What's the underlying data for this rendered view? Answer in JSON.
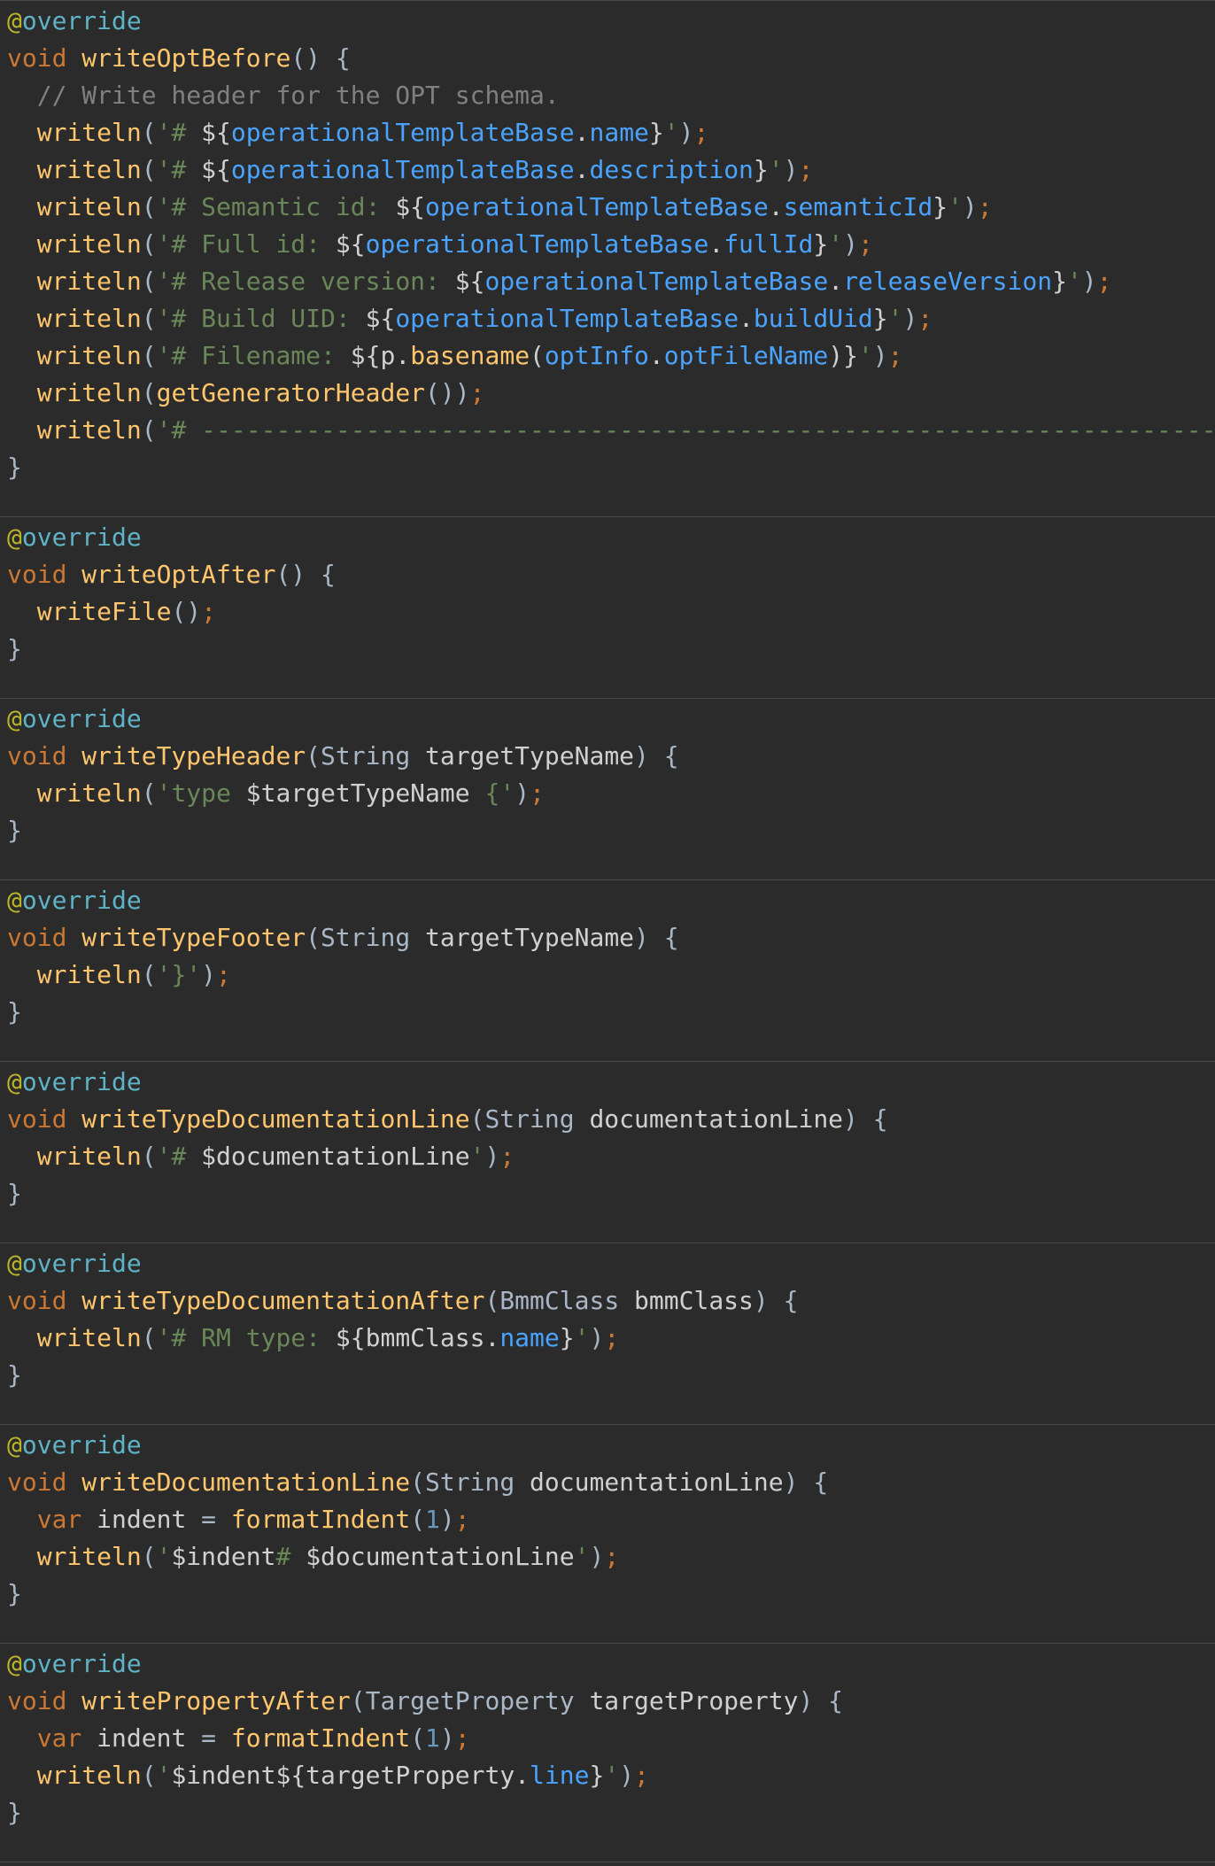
{
  "colors": {
    "background": "#2b2b2b",
    "annotation_at": "#bbb529",
    "annotation_name": "#5fb3c6",
    "keyword": "#cc7832",
    "method": "#ffc66d",
    "string": "#6a8759",
    "field": "#4aa3ff",
    "comment": "#808080",
    "number": "#6897bb",
    "plain": "#a9b7c6"
  },
  "code_blocks": [
    {
      "lines": [
        [
          [
            "ann",
            "@"
          ],
          [
            "ann2",
            "override"
          ]
        ],
        [
          [
            "kw",
            "void "
          ],
          [
            "def",
            "writeOptBefore"
          ],
          [
            "pl",
            "() {"
          ]
        ],
        [
          [
            "pl",
            "  "
          ],
          [
            "com",
            "// Write header for the OPT schema."
          ]
        ],
        [
          [
            "pl",
            "  "
          ],
          [
            "fn",
            "writeln"
          ],
          [
            "pl",
            "("
          ],
          [
            "str",
            "'# "
          ],
          [
            "id",
            "${"
          ],
          [
            "fld",
            "operationalTemplateBase"
          ],
          [
            "id",
            "."
          ],
          [
            "fld",
            "name"
          ],
          [
            "id",
            "}"
          ],
          [
            "str",
            "'"
          ],
          [
            "pl",
            ")"
          ],
          [
            "kw",
            ";"
          ]
        ],
        [
          [
            "pl",
            "  "
          ],
          [
            "fn",
            "writeln"
          ],
          [
            "pl",
            "("
          ],
          [
            "str",
            "'# "
          ],
          [
            "id",
            "${"
          ],
          [
            "fld",
            "operationalTemplateBase"
          ],
          [
            "id",
            "."
          ],
          [
            "fld",
            "description"
          ],
          [
            "id",
            "}"
          ],
          [
            "str",
            "'"
          ],
          [
            "pl",
            ")"
          ],
          [
            "kw",
            ";"
          ]
        ],
        [
          [
            "pl",
            "  "
          ],
          [
            "fn",
            "writeln"
          ],
          [
            "pl",
            "("
          ],
          [
            "str",
            "'# Semantic id: "
          ],
          [
            "id",
            "${"
          ],
          [
            "fld",
            "operationalTemplateBase"
          ],
          [
            "id",
            "."
          ],
          [
            "fld",
            "semanticId"
          ],
          [
            "id",
            "}"
          ],
          [
            "str",
            "'"
          ],
          [
            "pl",
            ")"
          ],
          [
            "kw",
            ";"
          ]
        ],
        [
          [
            "pl",
            "  "
          ],
          [
            "fn",
            "writeln"
          ],
          [
            "pl",
            "("
          ],
          [
            "str",
            "'# Full id: "
          ],
          [
            "id",
            "${"
          ],
          [
            "fld",
            "operationalTemplateBase"
          ],
          [
            "id",
            "."
          ],
          [
            "fld",
            "fullId"
          ],
          [
            "id",
            "}"
          ],
          [
            "str",
            "'"
          ],
          [
            "pl",
            ")"
          ],
          [
            "kw",
            ";"
          ]
        ],
        [
          [
            "pl",
            "  "
          ],
          [
            "fn",
            "writeln"
          ],
          [
            "pl",
            "("
          ],
          [
            "str",
            "'# Release version: "
          ],
          [
            "id",
            "${"
          ],
          [
            "fld",
            "operationalTemplateBase"
          ],
          [
            "id",
            "."
          ],
          [
            "fld",
            "releaseVersion"
          ],
          [
            "id",
            "}"
          ],
          [
            "str",
            "'"
          ],
          [
            "pl",
            ")"
          ],
          [
            "kw",
            ";"
          ]
        ],
        [
          [
            "pl",
            "  "
          ],
          [
            "fn",
            "writeln"
          ],
          [
            "pl",
            "("
          ],
          [
            "str",
            "'# Build UID: "
          ],
          [
            "id",
            "${"
          ],
          [
            "fld",
            "operationalTemplateBase"
          ],
          [
            "id",
            "."
          ],
          [
            "fld",
            "buildUid"
          ],
          [
            "id",
            "}"
          ],
          [
            "str",
            "'"
          ],
          [
            "pl",
            ")"
          ],
          [
            "kw",
            ";"
          ]
        ],
        [
          [
            "pl",
            "  "
          ],
          [
            "fn",
            "writeln"
          ],
          [
            "pl",
            "("
          ],
          [
            "str",
            "'# Filename: "
          ],
          [
            "id",
            "${p."
          ],
          [
            "fn",
            "basename"
          ],
          [
            "id",
            "("
          ],
          [
            "fld",
            "optInfo"
          ],
          [
            "id",
            "."
          ],
          [
            "fld",
            "optFileName"
          ],
          [
            "id",
            ")}"
          ],
          [
            "str",
            "'"
          ],
          [
            "pl",
            ")"
          ],
          [
            "kw",
            ";"
          ]
        ],
        [
          [
            "pl",
            "  "
          ],
          [
            "fn",
            "writeln"
          ],
          [
            "pl",
            "("
          ],
          [
            "fn",
            "getGeneratorHeader"
          ],
          [
            "pl",
            "())"
          ],
          [
            "kw",
            ";"
          ]
        ],
        [
          [
            "pl",
            "  "
          ],
          [
            "fn",
            "writeln"
          ],
          [
            "pl",
            "("
          ],
          [
            "str",
            "'# ----------------------------------------------------------------------'"
          ],
          [
            "pl",
            ")"
          ],
          [
            "kw",
            ";"
          ]
        ],
        [
          [
            "pl",
            "}"
          ]
        ]
      ]
    },
    {
      "lines": [
        [
          [
            "ann",
            "@"
          ],
          [
            "ann2",
            "override"
          ]
        ],
        [
          [
            "kw",
            "void "
          ],
          [
            "def",
            "writeOptAfter"
          ],
          [
            "pl",
            "() {"
          ]
        ],
        [
          [
            "pl",
            "  "
          ],
          [
            "fn",
            "writeFile"
          ],
          [
            "pl",
            "()"
          ],
          [
            "kw",
            ";"
          ]
        ],
        [
          [
            "pl",
            "}"
          ]
        ]
      ]
    },
    {
      "lines": [
        [
          [
            "ann",
            "@"
          ],
          [
            "ann2",
            "override"
          ]
        ],
        [
          [
            "kw",
            "void "
          ],
          [
            "def",
            "writeTypeHeader"
          ],
          [
            "pl",
            "(String "
          ],
          [
            "id",
            "targetTypeName"
          ],
          [
            "pl",
            ") {"
          ]
        ],
        [
          [
            "pl",
            "  "
          ],
          [
            "fn",
            "writeln"
          ],
          [
            "pl",
            "("
          ],
          [
            "str",
            "'type "
          ],
          [
            "id",
            "$targetTypeName"
          ],
          [
            "str",
            " {'"
          ],
          [
            "pl",
            ")"
          ],
          [
            "kw",
            ";"
          ]
        ],
        [
          [
            "pl",
            "}"
          ]
        ]
      ]
    },
    {
      "lines": [
        [
          [
            "ann",
            "@"
          ],
          [
            "ann2",
            "override"
          ]
        ],
        [
          [
            "kw",
            "void "
          ],
          [
            "def",
            "writeTypeFooter"
          ],
          [
            "pl",
            "(String "
          ],
          [
            "id",
            "targetTypeName"
          ],
          [
            "pl",
            ") {"
          ]
        ],
        [
          [
            "pl",
            "  "
          ],
          [
            "fn",
            "writeln"
          ],
          [
            "pl",
            "("
          ],
          [
            "str",
            "'}'"
          ],
          [
            "pl",
            ")"
          ],
          [
            "kw",
            ";"
          ]
        ],
        [
          [
            "pl",
            "}"
          ]
        ]
      ]
    },
    {
      "lines": [
        [
          [
            "ann",
            "@"
          ],
          [
            "ann2",
            "override"
          ]
        ],
        [
          [
            "kw",
            "void "
          ],
          [
            "def",
            "writeTypeDocumentationLine"
          ],
          [
            "pl",
            "(String "
          ],
          [
            "id",
            "documentationLine"
          ],
          [
            "pl",
            ") {"
          ]
        ],
        [
          [
            "pl",
            "  "
          ],
          [
            "fn",
            "writeln"
          ],
          [
            "pl",
            "("
          ],
          [
            "str",
            "'# "
          ],
          [
            "id",
            "$documentationLine"
          ],
          [
            "str",
            "'"
          ],
          [
            "pl",
            ")"
          ],
          [
            "kw",
            ";"
          ]
        ],
        [
          [
            "pl",
            "}"
          ]
        ]
      ]
    },
    {
      "lines": [
        [
          [
            "ann",
            "@"
          ],
          [
            "ann2",
            "override"
          ]
        ],
        [
          [
            "kw",
            "void "
          ],
          [
            "def",
            "writeTypeDocumentationAfter"
          ],
          [
            "pl",
            "(BmmClass "
          ],
          [
            "id",
            "bmmClass"
          ],
          [
            "pl",
            ") {"
          ]
        ],
        [
          [
            "pl",
            "  "
          ],
          [
            "fn",
            "writeln"
          ],
          [
            "pl",
            "("
          ],
          [
            "str",
            "'# RM type: "
          ],
          [
            "id",
            "${bmmClass."
          ],
          [
            "fld",
            "name"
          ],
          [
            "id",
            "}"
          ],
          [
            "str",
            "'"
          ],
          [
            "pl",
            ")"
          ],
          [
            "kw",
            ";"
          ]
        ],
        [
          [
            "pl",
            "}"
          ]
        ]
      ]
    },
    {
      "lines": [
        [
          [
            "ann",
            "@"
          ],
          [
            "ann2",
            "override"
          ]
        ],
        [
          [
            "kw",
            "void "
          ],
          [
            "def",
            "writeDocumentationLine"
          ],
          [
            "pl",
            "(String "
          ],
          [
            "id",
            "documentationLine"
          ],
          [
            "pl",
            ") {"
          ]
        ],
        [
          [
            "pl",
            "  "
          ],
          [
            "kw",
            "var "
          ],
          [
            "id",
            "indent "
          ],
          [
            "pl",
            "= "
          ],
          [
            "fn",
            "formatIndent"
          ],
          [
            "pl",
            "("
          ],
          [
            "num",
            "1"
          ],
          [
            "pl",
            ")"
          ],
          [
            "kw",
            ";"
          ]
        ],
        [
          [
            "pl",
            "  "
          ],
          [
            "fn",
            "writeln"
          ],
          [
            "pl",
            "("
          ],
          [
            "str",
            "'"
          ],
          [
            "id",
            "$indent"
          ],
          [
            "str",
            "# "
          ],
          [
            "id",
            "$documentationLine"
          ],
          [
            "str",
            "'"
          ],
          [
            "pl",
            ")"
          ],
          [
            "kw",
            ";"
          ]
        ],
        [
          [
            "pl",
            "}"
          ]
        ]
      ]
    },
    {
      "lines": [
        [
          [
            "ann",
            "@"
          ],
          [
            "ann2",
            "override"
          ]
        ],
        [
          [
            "kw",
            "void "
          ],
          [
            "def",
            "writePropertyAfter"
          ],
          [
            "pl",
            "(TargetProperty "
          ],
          [
            "id",
            "targetProperty"
          ],
          [
            "pl",
            ") {"
          ]
        ],
        [
          [
            "pl",
            "  "
          ],
          [
            "kw",
            "var "
          ],
          [
            "id",
            "indent "
          ],
          [
            "pl",
            "= "
          ],
          [
            "fn",
            "formatIndent"
          ],
          [
            "pl",
            "("
          ],
          [
            "num",
            "1"
          ],
          [
            "pl",
            ")"
          ],
          [
            "kw",
            ";"
          ]
        ],
        [
          [
            "pl",
            "  "
          ],
          [
            "fn",
            "writeln"
          ],
          [
            "pl",
            "("
          ],
          [
            "str",
            "'"
          ],
          [
            "id",
            "$indent${targetProperty."
          ],
          [
            "fld",
            "line"
          ],
          [
            "id",
            "}"
          ],
          [
            "str",
            "'"
          ],
          [
            "pl",
            ")"
          ],
          [
            "kw",
            ";"
          ]
        ],
        [
          [
            "pl",
            "}"
          ]
        ]
      ]
    }
  ]
}
